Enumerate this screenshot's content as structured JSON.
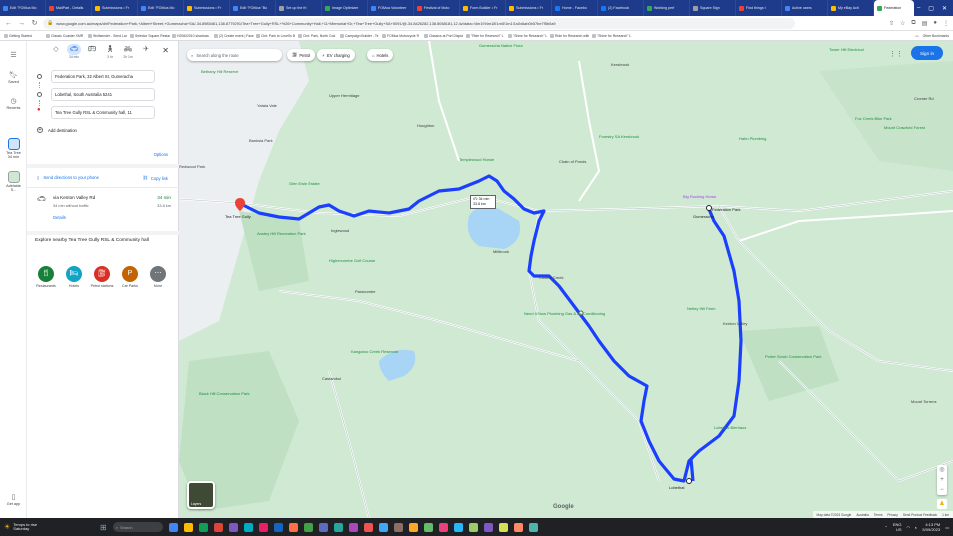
{
  "browser": {
    "tabs": [
      "Edit \"FOMoa Mo",
      "MailPart - Details",
      "Submissions • Fr",
      "Edit \"FOMoa Mo",
      "Submissions • Fr",
      "Edit \"FOMoa \"Bo",
      "Set up the fri",
      "Image Optimizer",
      "FOMoa Volunteer",
      "Festival of Moto",
      "Form Builder • Fr",
      "Submissions • Fr",
      "Home - Facebo",
      "(2) Facebook",
      "Working perf",
      "Square Sign",
      "Find things t",
      "Active users",
      "My eBay Acti"
    ],
    "active_tab": "Federation",
    "url": "www.google.com.au/maps/dir/Federation+Park,+Albert+Street,+Gumeracha+SA/-34.8985461,138.8779291/Tea+Tree+Gully+RSL+%26+Community+Hall,+11+Memorial+Dr,+Tea+Tree+Gully+SA+5091/@-34.8426282,138.8068181,12.4z/data=!4m19!4m18!1m5!1m1!1s0x6ab0b57be7f5b0a9",
    "bookmarks": [
      "Getting Started",
      "Classic Coaster XMR",
      "Wolfsender - Send Lar",
      "Selector Square Restau",
      "H20602010 shadows",
      "(2) Create event | Face",
      "Clnt: Park to Lovell's B",
      "Clnt: Park, North Cod",
      "Campaign Builder - Te",
      "FOMoa Motorcycle R",
      "Classics at Port Displa",
      "\"Ride for Research\" L",
      "\"Shine for Research\" L",
      "Ride for Research with",
      "\"Shine for Research\" L"
    ],
    "other_bookmarks": "Other Bookmarks"
  },
  "rail": {
    "saved": "Saved",
    "recents": "Recents",
    "tea_tree": "Tea Tree",
    "tea_tree_time": "34 min",
    "adelaide": "Adelaide",
    "adelaide_sub": "S...",
    "get_app": "Get app"
  },
  "directions": {
    "modes": [
      {
        "label": "",
        "icon": "diamond-icon"
      },
      {
        "label": "34 min",
        "icon": "car-icon"
      },
      {
        "label": "",
        "icon": "bus-icon"
      },
      {
        "label": "3 hr",
        "icon": "walk-icon"
      },
      {
        "label": "2h 1m",
        "icon": "bike-icon"
      },
      {
        "label": "",
        "icon": "plane-icon"
      }
    ],
    "waypoints": [
      "Federation Park, 32 Albert St, Gumeracha",
      "Lobethal, South Australia 5241",
      "Tea Tree Gully RSL & Community hall, 11"
    ],
    "add_destination": "Add destination",
    "options": "Options",
    "send_to_phone": "Send directions to your phone",
    "copy_link": "Copy link",
    "route": {
      "via": "via Kenton Valley Rd",
      "sub": "34 min without traffic",
      "time": "34 min",
      "distance": "33.8 km",
      "details": "Details"
    },
    "explore": "Explore nearby Tea Tree Gully RSL & Community hall",
    "nearby": [
      {
        "label": "Restaurants",
        "icon": "fork-knife-icon",
        "color": "#188038"
      },
      {
        "label": "Hotels",
        "icon": "bed-icon",
        "color": "#12a4c4"
      },
      {
        "label": "Petrol stations",
        "icon": "fuel-icon",
        "color": "#d93025"
      },
      {
        "label": "Car Parks",
        "icon": "parking-icon",
        "color": "#c26401"
      },
      {
        "label": "More",
        "icon": "more-icon",
        "color": "#70757a"
      }
    ]
  },
  "map": {
    "search_placeholder": "Search along the route",
    "chips": [
      "Petrol",
      "EV charging",
      "Hotels"
    ],
    "sign_in": "Sign in",
    "layers": "Layers",
    "route_box": {
      "time": "34 min",
      "dist": "33.8 km"
    },
    "labels": [
      {
        "text": "Yatala Vale",
        "cls": ""
      },
      {
        "text": "Banksia Park",
        "cls": ""
      },
      {
        "text": "Redwood Park",
        "cls": ""
      },
      {
        "text": "Tea Tree Gully",
        "cls": "bold"
      },
      {
        "text": "Upper Hermitage",
        "cls": ""
      },
      {
        "text": "Houghton",
        "cls": ""
      },
      {
        "text": "Inglewood",
        "cls": ""
      },
      {
        "text": "Paracombe",
        "cls": ""
      },
      {
        "text": "Millbrook",
        "cls": ""
      },
      {
        "text": "Cudlee Creek",
        "cls": ""
      },
      {
        "text": "Chain of Ponds",
        "cls": ""
      },
      {
        "text": "Gumeracha",
        "cls": "bold"
      },
      {
        "text": "Federation Park",
        "cls": "bold"
      },
      {
        "text": "Kenton Valley",
        "cls": ""
      },
      {
        "text": "Lobethal",
        "cls": "bold"
      },
      {
        "text": "Cherryville",
        "cls": ""
      },
      {
        "text": "Castambul",
        "cls": ""
      },
      {
        "text": "Kersbrook",
        "cls": ""
      },
      {
        "text": "Mount Torrens",
        "cls": ""
      },
      {
        "text": "Big Rocking Horse",
        "cls": "pink"
      },
      {
        "text": "Templewood Horsie",
        "cls": "poi"
      },
      {
        "text": "Glen Ewin Estate",
        "cls": "poi"
      },
      {
        "text": "Highercombe Golf Course",
        "cls": "poi"
      },
      {
        "text": "Kangaroo Creek Reservoir",
        "cls": "poi"
      },
      {
        "text": "Black Hill Conservation Park",
        "cls": "poi"
      },
      {
        "text": "Anstey Hill Recreation Park",
        "cls": "poi"
      },
      {
        "text": "Netley Hill Farm",
        "cls": "poi"
      },
      {
        "text": "Porter Scrub Conservation Park",
        "cls": "poi"
      },
      {
        "text": "Lobethal Bierhaus",
        "cls": "poi"
      },
      {
        "text": "Fox Creek Bike Park",
        "cls": "poi"
      },
      {
        "text": "Hahn Plumbing",
        "cls": "poi"
      },
      {
        "text": "Need It Now Plumbing Gas & Air Conditioning",
        "cls": "poi"
      },
      {
        "text": "Bethany Hill Reserve",
        "cls": "poi"
      },
      {
        "text": "Forestry SA Kersbrook",
        "cls": "poi"
      },
      {
        "text": "Gumeracha Native Flora",
        "cls": "poi"
      },
      {
        "text": "Tower Hill Electrical",
        "cls": "poi"
      },
      {
        "text": "Cromer Rd",
        "cls": ""
      },
      {
        "text": "Mount Crawford Forest",
        "cls": "poi"
      }
    ],
    "attribution": [
      "Map data ©2023 Google",
      "Australia",
      "Terms",
      "Privacy",
      "Send Product Feedback",
      "1 km"
    ]
  },
  "taskbar": {
    "weather_title": "Temps to rise",
    "weather_day": "Saturday",
    "search_label": "Search",
    "lang": "ENG",
    "region": "US",
    "time": "4:13 PM",
    "date": "5/09/2023"
  }
}
